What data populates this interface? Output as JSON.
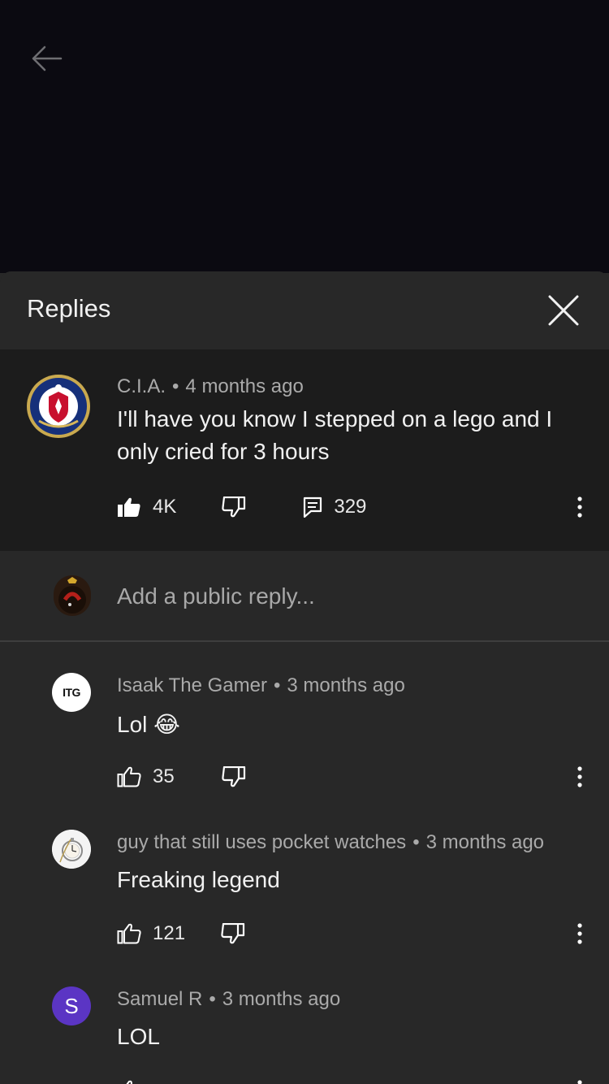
{
  "panel": {
    "title": "Replies"
  },
  "parent_comment": {
    "author": "C.I.A.",
    "time": "4 months ago",
    "text_line1": "I'll have you know I stepped on a lego and I",
    "text_line2": "only cried for 3 hours",
    "likes": "4K",
    "replies": "329",
    "like_state": "liked"
  },
  "add_reply": {
    "placeholder": "Add a public reply..."
  },
  "replies": [
    {
      "author": "Isaak The Gamer",
      "time": "3 months ago",
      "text": "Lol",
      "emoji": "😂",
      "likes": "35",
      "avatar_text": "ITG"
    },
    {
      "author": "guy that still uses pocket watches",
      "time": "3 months ago",
      "text": "Freaking legend",
      "likes": "121"
    },
    {
      "author": "Samuel R",
      "time": "3 months ago",
      "text": "LOL",
      "avatar_letter": "S"
    }
  ],
  "colors": {
    "background": "#282828",
    "parent_bg": "#1c1c1c",
    "video_bg": "#0b0a11",
    "avatar_s": "#5b35c4"
  }
}
